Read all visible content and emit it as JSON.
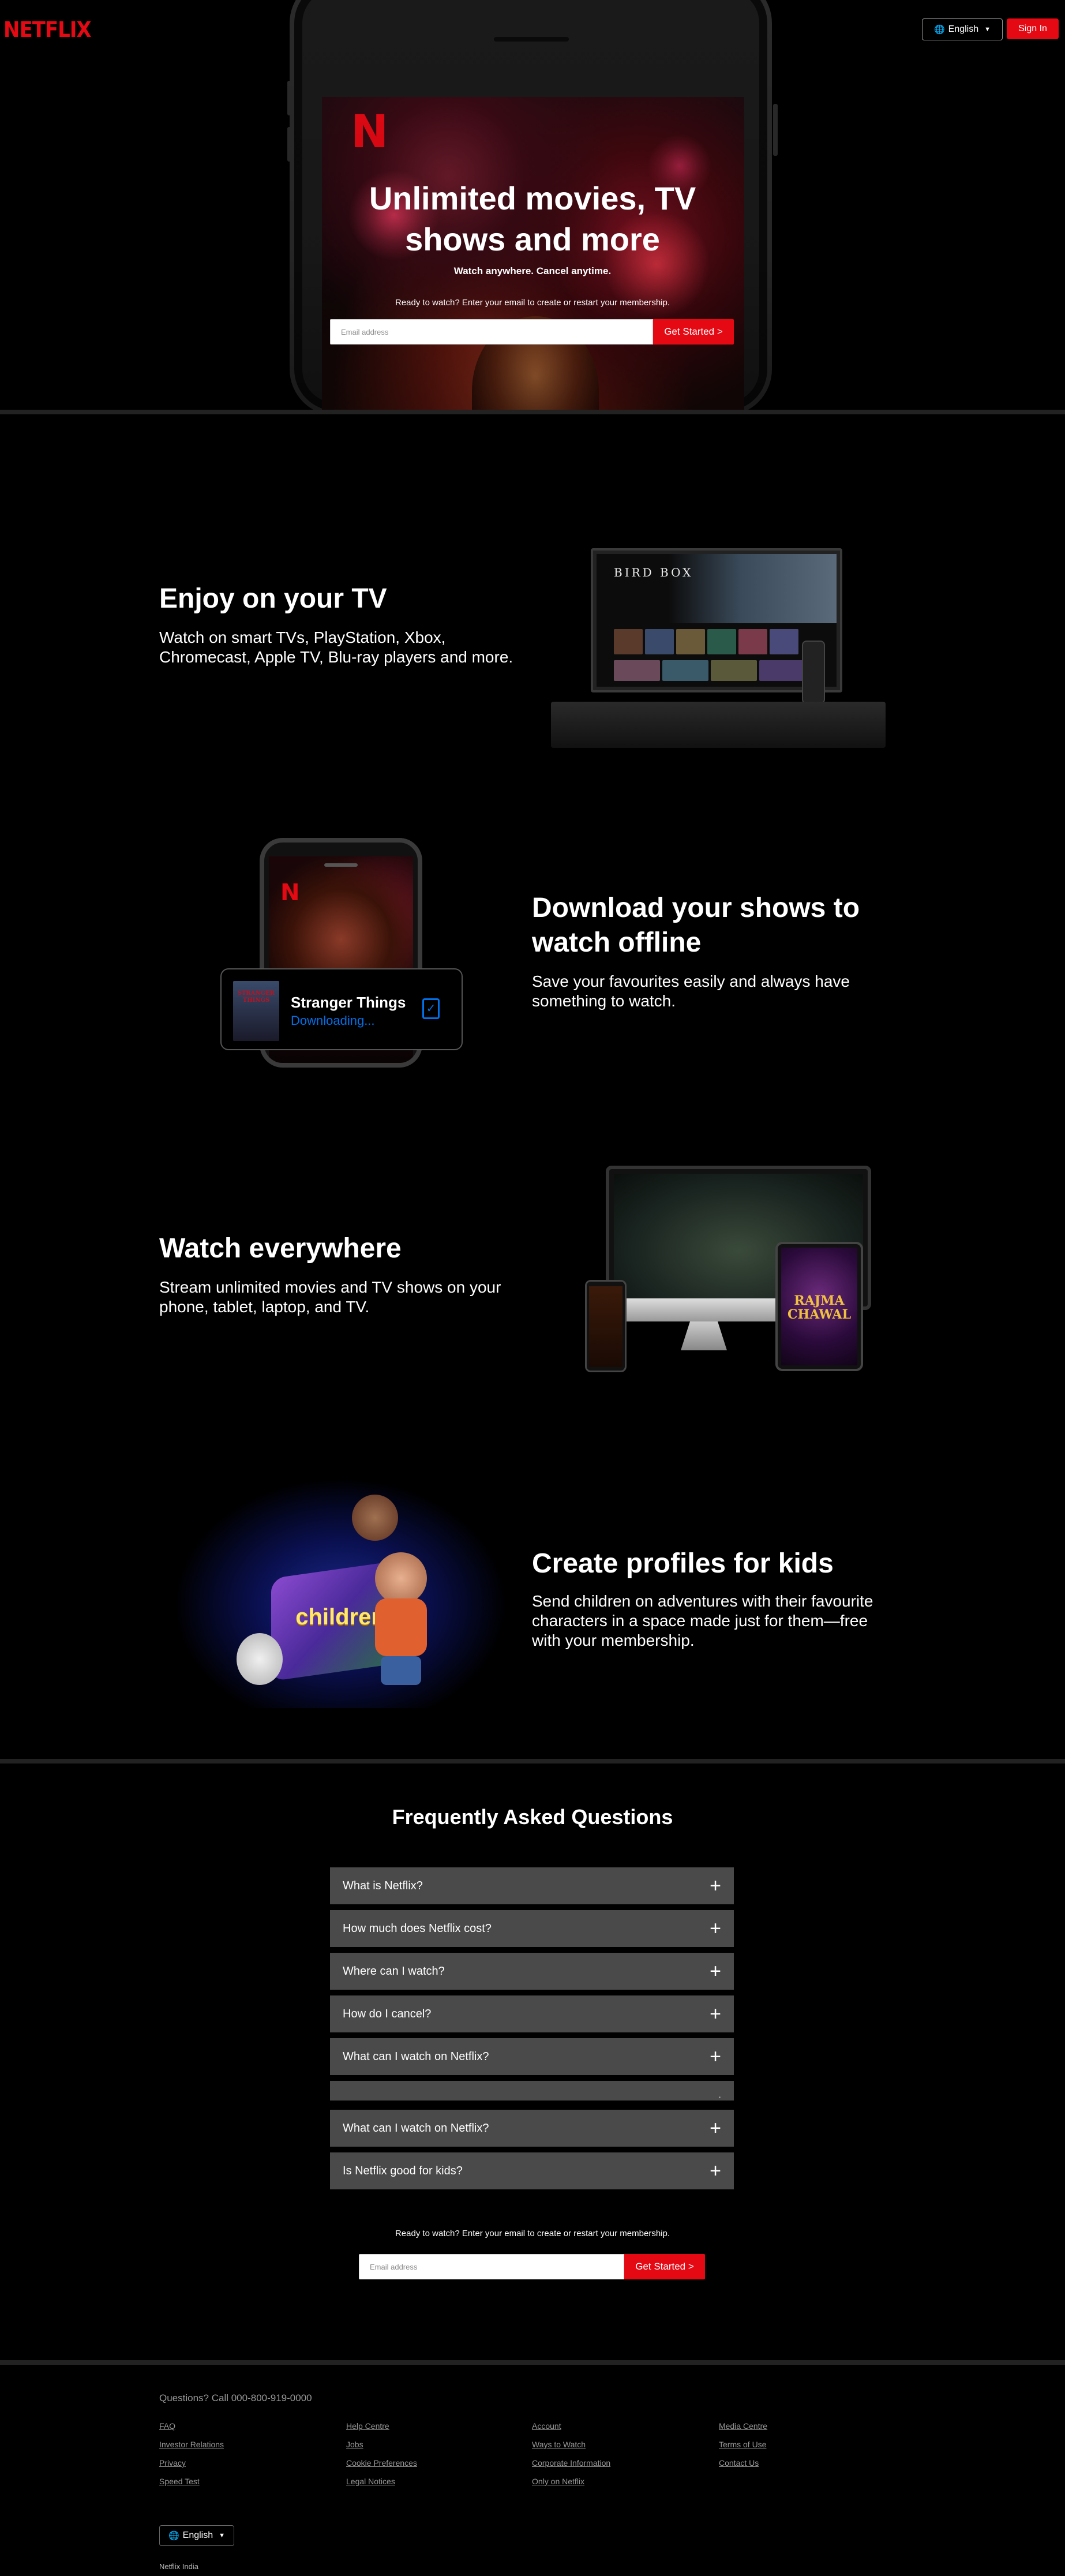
{
  "header": {
    "logo": "NETFLIX",
    "language": "English",
    "sign_in": "Sign In"
  },
  "hero": {
    "screen_logo": "N",
    "title_line1": "Unlimited movies, TV",
    "title_line2": "shows and more",
    "subtitle": "Watch anywhere. Cancel anytime.",
    "cta_text": "Ready to watch? Enter your email to create or restart your membership.",
    "email_placeholder": "Email address",
    "button": "Get Started >"
  },
  "features": [
    {
      "title": "Enjoy on your TV",
      "text_line1": "Watch on smart TVs, PlayStation, Xbox,",
      "text_line2": "Chromecast, Apple TV, Blu-ray players and more.",
      "tv_title": "BIRD BOX"
    },
    {
      "title_line1": "Download your shows to",
      "title_line2": "watch offline",
      "text_line1": "Save your favourites easily and always have",
      "text_line2": "something to watch.",
      "card_title": "Stranger Things",
      "card_status": "Downloading...",
      "poster_text": "STRANGER THINGS"
    },
    {
      "title": "Watch everywhere",
      "text_line1": "Stream unlimited movies and TV shows on your",
      "text_line2": "phone, tablet, laptop, and TV.",
      "tablet_title": "RAJMA CHAWAL"
    },
    {
      "title": "Create profiles for kids",
      "text_line1": "Send children on adventures with their favourite",
      "text_line2": "characters in a space made just for them—free",
      "text_line3": "with your membership.",
      "kids_label": "children"
    }
  ],
  "faq": {
    "title": "Frequently Asked Questions",
    "items": [
      "What is Netflix?",
      "How much does Netflix cost?",
      "Where can I watch?",
      "How do I cancel?",
      "What can I watch on Netflix?",
      "",
      "What can I watch on Netflix?",
      "Is Netflix good for kids?"
    ]
  },
  "cta2": {
    "text": "Ready to watch? Enter your email to create or restart your membership.",
    "email_placeholder": "Email address",
    "button": "Get Started >"
  },
  "footer": {
    "questions": "Questions? Call 000-800-919-0000",
    "links": [
      "FAQ",
      "Investor Relations",
      "Privacy",
      "Speed Test",
      "Help Centre",
      "Jobs",
      "Cookie Preferences",
      "Legal Notices",
      "Account",
      "Ways to Watch",
      "Corporate Information",
      "Only on Netflix",
      "Media Centre",
      "Terms of Use",
      "Contact Us"
    ],
    "language": "English",
    "country": "Netflix India"
  },
  "colors": {
    "brand_red": "#e50914",
    "download_blue": "#0071eb",
    "faq_bg": "#4a4a4a",
    "background": "#000000"
  },
  "icons": [
    "globe-icon",
    "caret-down-icon",
    "plus-icon",
    "download-check-icon"
  ]
}
